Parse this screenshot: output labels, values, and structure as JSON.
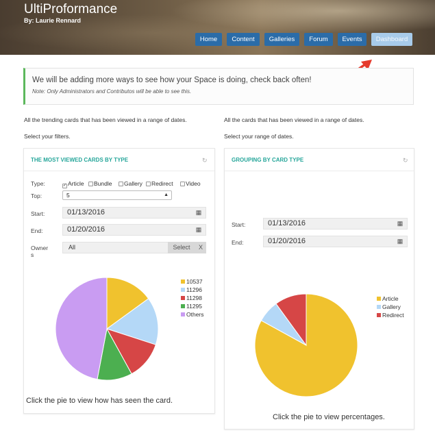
{
  "site": {
    "title": "UltiProformance",
    "author": "By: Laurie Rennard"
  },
  "nav": {
    "items": [
      {
        "label": "Home",
        "active": false
      },
      {
        "label": "Content",
        "active": false
      },
      {
        "label": "Galleries",
        "active": false
      },
      {
        "label": "Forum",
        "active": false
      },
      {
        "label": "Events",
        "active": false
      },
      {
        "label": "Dashboard",
        "active": true
      }
    ]
  },
  "notice": {
    "message": "We will be adding more ways to see how your Space is doing, check back often!",
    "note": "Note: Only Administrators and Contributos will be able to see this."
  },
  "left_intro": {
    "line1": "All the trending cards that has been viewed in a range of dates.",
    "line2": "Select your filters."
  },
  "right_intro": {
    "line1": "All the cards that has been viewed in a range of dates.",
    "line2": "Select your range of dates."
  },
  "left_panel": {
    "title": "THE MOST VIEWED CARDS BY TYPE",
    "refresh_icon": "refresh-icon",
    "type_label": "Type:",
    "types": [
      {
        "label": "Article",
        "checked": true
      },
      {
        "label": "Bundle",
        "checked": false
      },
      {
        "label": "Gallery",
        "checked": false
      },
      {
        "label": "Redirect",
        "checked": false
      },
      {
        "label": "Video",
        "checked": false
      }
    ],
    "top_label": "Top:",
    "top_value": "5",
    "start_label": "Start:",
    "start_value": "01/13/2016",
    "end_label": "End:",
    "end_value": "01/20/2016",
    "owners_label_1": "Owner",
    "owners_label_2": "s",
    "owners_value": "All",
    "select_label": "Select",
    "clear_label": "X",
    "hint": "Click the pie to view how has seen the card."
  },
  "right_panel": {
    "title": "GROUPING BY CARD TYPE",
    "refresh_icon": "refresh-icon",
    "start_label": "Start:",
    "start_value": "01/13/2016",
    "end_label": "End:",
    "end_value": "01/20/2016",
    "hint": "Click the pie to view percentages."
  },
  "chart_data": [
    {
      "type": "pie",
      "title": "",
      "labels": [
        "10537",
        "11296",
        "11298",
        "11295",
        "Others"
      ],
      "values": [
        15,
        15,
        12,
        11,
        47
      ],
      "colors": [
        "#f0c22e",
        "#b4d8f7",
        "#d64646",
        "#4caf50",
        "#c99cf2"
      ]
    },
    {
      "type": "pie",
      "title": "",
      "labels": [
        "Article",
        "Gallery",
        "Redirect"
      ],
      "values": [
        83,
        7,
        10
      ],
      "colors": [
        "#f0c22e",
        "#b4d8f7",
        "#d64646"
      ]
    }
  ]
}
